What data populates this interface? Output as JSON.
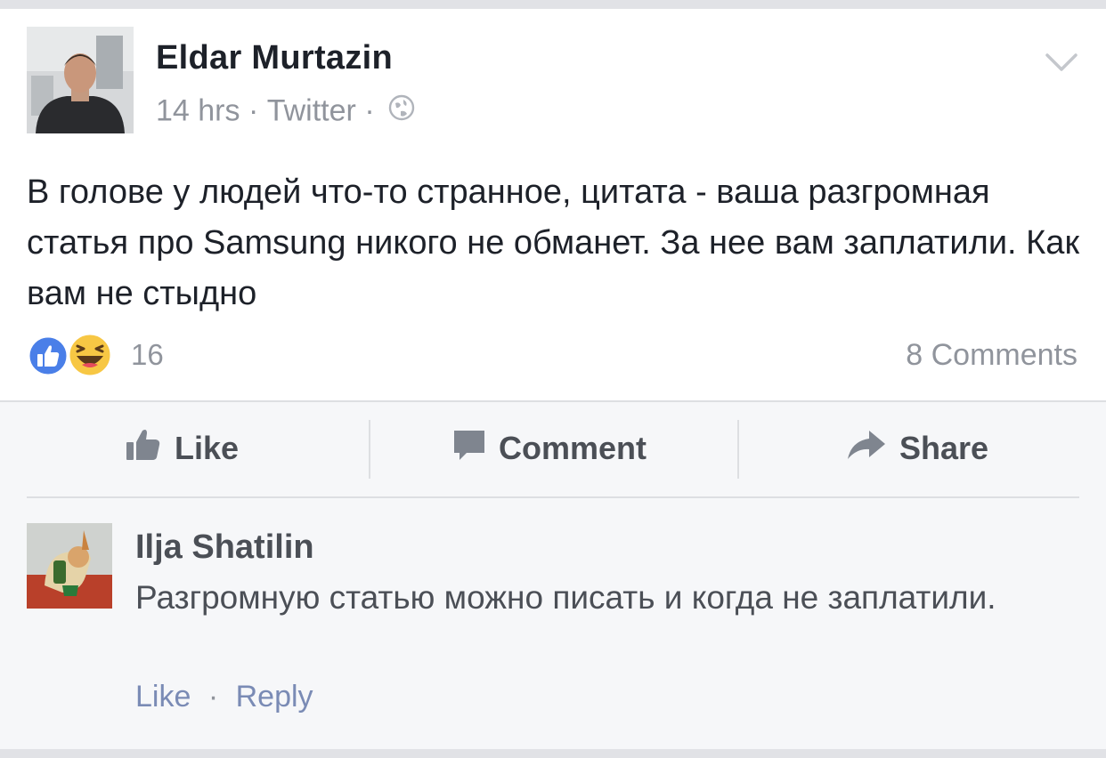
{
  "post": {
    "author": "Eldar Murtazin",
    "time": "14 hrs",
    "source": "Twitter",
    "separator": "·",
    "privacy_icon": "globe-icon",
    "menu_icon": "chevron-down-icon",
    "text": "В голове у людей что-то странное, цитата - ваша разгромная статья про Samsung никого не обманет. За нее вам заплатили. Как вам не стыдно",
    "reactions": [
      "like-reaction-icon",
      "haha-reaction-icon"
    ],
    "reaction_count": "16",
    "comments_count": "8 Comments"
  },
  "actions": {
    "like": "Like",
    "comment": "Comment",
    "share": "Share"
  },
  "comment": {
    "author": "Ilja Shatilin",
    "text": "Разгромную статью можно писать и когда не заплатили.",
    "like": "Like",
    "separator": "·",
    "reply": "Reply"
  },
  "colors": {
    "page_bg": "#e9ebee",
    "card_bg": "#ffffff",
    "text_primary": "#1d2129",
    "text_secondary": "#90949c",
    "action_text": "#4b4f56",
    "link": "#7a8bb5",
    "like_blue": "#4a7fe8",
    "haha_yellow": "#f7c744"
  }
}
